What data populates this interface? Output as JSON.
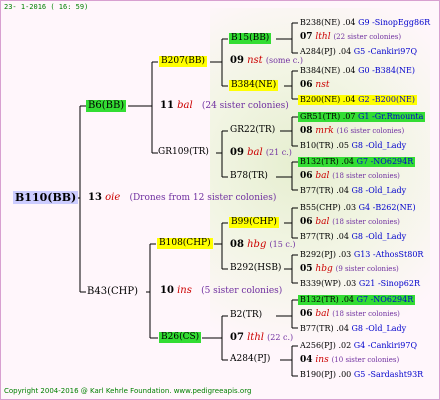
{
  "header": "23- 1-2016 ( 16: 59)",
  "footer": "Copyright 2004-2016 @ Karl Kehrle Foundation.   www.pedigreeapis.org",
  "root": "B110(BB)",
  "gen1": {
    "year": "13",
    "code": "oie",
    "siblings": "(Drones from 12 sister colonies)",
    "father": "B6(BB)",
    "mother": "B43(CHP)"
  },
  "gen2": [
    {
      "year": "11",
      "code": "bal",
      "siblings": "(24 sister colonies)",
      "father": "B207(BB)",
      "mother": "GR109(TR)"
    },
    {
      "year": "10",
      "code": "ins",
      "siblings": "(5 sister colonies)",
      "father": "B108(CHP)",
      "mother": "B26(CS)"
    }
  ],
  "gen3": [
    {
      "year": "09",
      "code": "nst",
      "siblings": "(some c.)",
      "father": "B15(BB)",
      "mother": "B384(NE)"
    },
    {
      "year": "09",
      "code": "bal",
      "siblings": "(21 c.)",
      "father": "GR22(TR)",
      "mother": "B78(TR)"
    },
    {
      "year": "08",
      "code": "hbg",
      "siblings": "(15 c.)",
      "father": "B99(CHP)",
      "mother": "B292(HSB)"
    },
    {
      "year": "07",
      "code": "lthl",
      "siblings": "(22 c.)",
      "father": "B2(TR)",
      "mother": "A284(PJ)"
    }
  ],
  "gen4": [
    {
      "father": "B238(NE)",
      "fy": ".04",
      "fl": "G9 -SinopEgg86R",
      "year": "07",
      "code": "lthl",
      "sis": "(22 sister colonies)",
      "mother": "A284(PJ)",
      "my": ".04",
      "ml": "G5 -Cankiri97Q"
    },
    {
      "father": "B384(NE)",
      "fy": ".04",
      "fl": "G0 -B384(NE)",
      "year": "06",
      "code": "nst",
      "sis": "",
      "mother": "B200(NE)",
      "my": ".04",
      "ml": "G2 -B200(NE)"
    },
    {
      "father": "GR51(TR)",
      "fy": ".07",
      "fl": "G1 -Gr.Rmounta",
      "year": "08",
      "code": "mrk",
      "sis": "(16 sister colonies)",
      "mother": "B10(TR)",
      "my": ".05",
      "ml": "G8 -Old_Lady"
    },
    {
      "father": "B132(TR)",
      "fy": ".04",
      "fl": "G7 -NO6294R",
      "year": "06",
      "code": "bal",
      "sis": "(18 sister colonies)",
      "mother": "B77(TR)",
      "my": ".04",
      "ml": "G8 -Old_Lady"
    },
    {
      "father": "B55(CHP)",
      "fy": ".03",
      "fl": "G4 -B262(NE)",
      "year": "06",
      "code": "bal",
      "sis": "(18 sister colonies)",
      "mother": "B77(TR)",
      "my": ".04",
      "ml": "G8 -Old_Lady"
    },
    {
      "father": "B292(PJ)",
      "fy": ".03",
      "fl": "G13 -AthosSt80R",
      "year": "05",
      "code": "hbg",
      "sis": "(9 sister colonies)",
      "mother": "B339(WP)",
      "my": ".03",
      "ml": "G21 -Sinop62R"
    },
    {
      "father": "B132(TR)",
      "fy": ".04",
      "fl": "G7 -NO6294R",
      "year": "06",
      "code": "bal",
      "sis": "(18 sister colonies)",
      "mother": "B77(TR)",
      "my": ".04",
      "ml": "G8 -Old_Lady"
    },
    {
      "father": "A256(PJ)",
      "fy": ".02",
      "fl": "G4 -Cankiri97Q",
      "year": "04",
      "code": "ins",
      "sis": "(10 sister colonies)",
      "mother": "B190(PJ)",
      "my": ".00",
      "ml": "G5 -Sardasht93R"
    }
  ]
}
